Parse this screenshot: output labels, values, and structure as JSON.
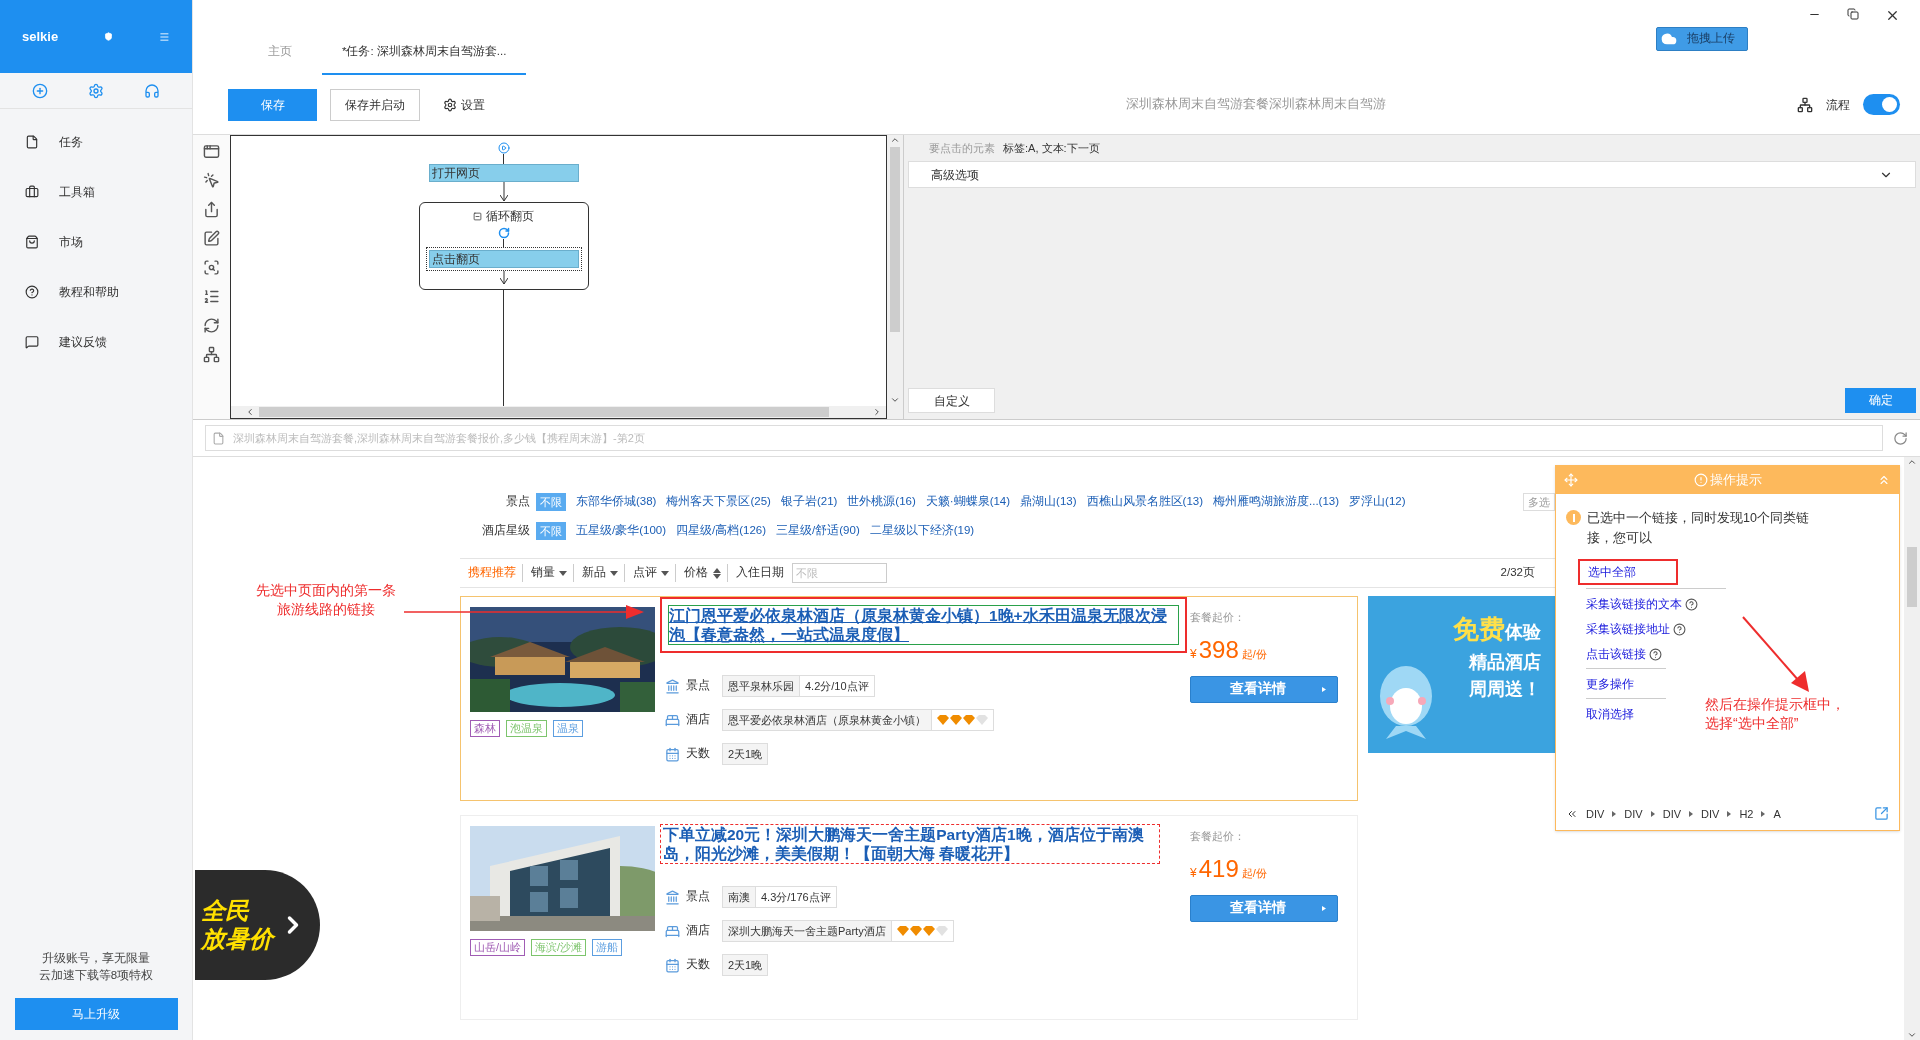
{
  "app": {
    "name": "selkie"
  },
  "sidebar": {
    "items": [
      {
        "kind": "task",
        "label": "任务",
        "selected": false
      },
      {
        "kind": "tools",
        "label": "工具箱",
        "selected": false
      },
      {
        "kind": "market",
        "label": "市场",
        "selected": false
      },
      {
        "kind": "help",
        "label": "教程和帮助",
        "selected": false
      },
      {
        "kind": "feedback",
        "label": "建议反馈",
        "selected": false
      }
    ],
    "promo_lines": [
      "升级账号，享无限量",
      "云加速下载等8项特权"
    ],
    "upgrade_button": "马上升级"
  },
  "tabs": [
    {
      "label": "主页",
      "selected": false
    },
    {
      "label": "*任务: 深圳森林周末自驾游套...",
      "selected": true
    }
  ],
  "upload_button": "拖拽上传",
  "toolbar": {
    "save": "保存",
    "save_start": "保存并启动",
    "settings": "设置",
    "task_name": "深圳森林周末自驾游套餐深圳森林周末自驾游",
    "flow_label": "流程",
    "flow_on": true
  },
  "flow": {
    "nodes": [
      {
        "kind": "step",
        "label": "打开网页",
        "selected": false
      },
      {
        "kind": "loop",
        "label": "循环翻页",
        "expanded": true,
        "children": [
          {
            "kind": "step",
            "label": "点击翻页",
            "selected": true
          }
        ]
      }
    ]
  },
  "options": {
    "element_label": "要点击的元素",
    "element_value": "标签:A, 文本:下一页",
    "advanced": "高级选项",
    "custom_button": "自定义",
    "ok_button": "确定"
  },
  "browser": {
    "url": "深圳森林周末自驾游套餐,深圳森林周末自驾游套餐报价,多少钱【携程周末游】-第2页"
  },
  "filters": [
    {
      "label": "景点",
      "all": "不限",
      "options": [
        "东部华侨城(38)",
        "梅州客天下景区(25)",
        "银子岩(21)",
        "世外桃源(16)",
        "天籁·蝴蝶泉(14)",
        "鼎湖山(13)",
        "西樵山风景名胜区(13)",
        "梅州雁鸣湖旅游度...(13)",
        "罗浮山(12)"
      ],
      "more": "多选"
    },
    {
      "label": "酒店星级",
      "all": "不限",
      "options": [
        "五星级/豪华(100)",
        "四星级/高档(126)",
        "三星级/舒适(90)",
        "二星级以下经济(19)"
      ]
    }
  ],
  "sort": {
    "items": [
      {
        "label": "携程推荐",
        "selected": true,
        "kind": "plain"
      },
      {
        "label": "销量",
        "selected": false,
        "kind": "down"
      },
      {
        "label": "新品",
        "selected": false,
        "kind": "down"
      },
      {
        "label": "点评",
        "selected": false,
        "kind": "down"
      },
      {
        "label": "价格",
        "selected": false,
        "kind": "updown"
      }
    ],
    "date_label": "入住日期",
    "date_placeholder": "不限",
    "page": "2/32页"
  },
  "annotations": [
    {
      "lines": [
        "先选中页面内的第一条",
        "旅游线路的链接"
      ]
    },
    {
      "lines": [
        "然后在操作提示框中，",
        "选择“选中全部”"
      ]
    }
  ],
  "listings": [
    {
      "title": "江门恩平爱必依泉林酒店（原泉林黄金小镇）1晚+水禾田温泉无限次浸泡【春意盎然，一站式温泉度假】",
      "kind": "selected",
      "price_label": "套餐起价：",
      "currency": "¥",
      "price": "398",
      "unit": "起/份",
      "button": "查看详情",
      "tags": [
        {
          "text": "森林",
          "color": "#a05cb4"
        },
        {
          "text": "泡温泉",
          "color": "#7cc46c"
        },
        {
          "text": "温泉",
          "color": "#5c9ee0"
        }
      ],
      "rows": [
        {
          "kind": "spot",
          "label": "景点",
          "values": [
            "恩平泉林乐园",
            "4.2分/10点评"
          ]
        },
        {
          "kind": "hotel",
          "label": "酒店",
          "values": [
            "恩平爱必依泉林酒店（原泉林黄金小镇）"
          ],
          "stars": 3
        },
        {
          "kind": "days",
          "label": "天数",
          "values": [
            "2天1晚"
          ]
        }
      ]
    },
    {
      "title": "下单立减20元！深圳大鹏海天一舍主题Party酒店1晚，酒店位于南澳岛，阳光沙滩，美美假期！【面朝大海 春暖花开】",
      "kind": "hover",
      "price_label": "套餐起价：",
      "currency": "¥",
      "price": "419",
      "unit": "起/份",
      "button": "查看详情",
      "tags": [
        {
          "text": "山岳/山岭",
          "color": "#a05cb4"
        },
        {
          "text": "海滨/沙滩",
          "color": "#7cc46c"
        },
        {
          "text": "游船",
          "color": "#5c9ee0"
        }
      ],
      "rows": [
        {
          "kind": "spot",
          "label": "景点",
          "values": [
            "南澳",
            "4.3分/176点评"
          ]
        },
        {
          "kind": "hotel",
          "label": "酒店",
          "values": [
            "深圳大鹏海天一舍主题Party酒店"
          ],
          "stars": 3
        },
        {
          "kind": "days",
          "label": "天数",
          "values": [
            "2天1晚"
          ]
        }
      ]
    }
  ],
  "ad": {
    "free": "免费",
    "free_rest": "体验",
    "line2": "精品酒店",
    "line3": "周周送！"
  },
  "promo_badge": {
    "lines": [
      "全民",
      "放暑价"
    ]
  },
  "popup": {
    "title": "操作提示",
    "message": "已选中一个链接，同时发现10个同类链接，您可以",
    "actions": [
      {
        "label": "选中全部",
        "help": false,
        "annotated": true,
        "divider_before": false
      },
      {
        "label": "采集该链接的文本",
        "help": true,
        "annotated": false,
        "divider_before": true
      },
      {
        "label": "采集该链接地址",
        "help": true,
        "annotated": false,
        "divider_before": false
      },
      {
        "label": "点击该链接",
        "help": true,
        "annotated": false,
        "divider_before": false
      },
      {
        "label": "更多操作",
        "help": false,
        "annotated": false,
        "divider_before": true
      },
      {
        "label": "取消选择",
        "help": false,
        "annotated": false,
        "divider_before": true
      }
    ],
    "path": [
      "DIV",
      "DIV",
      "DIV",
      "DIV",
      "H2",
      "A"
    ]
  }
}
